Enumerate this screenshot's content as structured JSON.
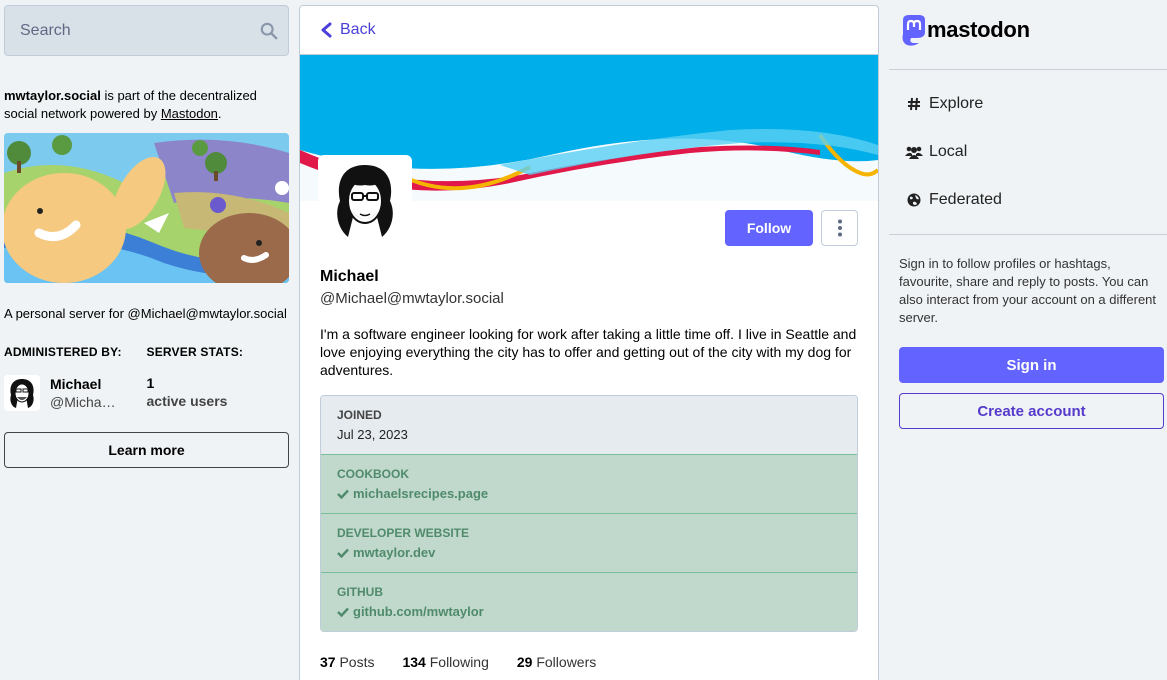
{
  "search": {
    "placeholder": "Search",
    "icon": "search-icon"
  },
  "server": {
    "domain": "mwtaylor.social",
    "about_middle": " is part of the decentralized social network powered by ",
    "about_link": "Mastodon",
    "about_end": ".",
    "description": "A personal server for @Michael@mwtaylor.social",
    "administered_by_label": "ADMINISTERED BY:",
    "server_stats_label": "SERVER STATS:",
    "admin_name": "Michael",
    "admin_handle": "@Michael@mwtaylor.social",
    "active_users_count": "1",
    "active_users_label": "active users",
    "learn_more": "Learn more"
  },
  "profile": {
    "back_label": "Back",
    "follow_label": "Follow",
    "display_name": "Michael",
    "handle": "@Michael@mwtaylor.social",
    "bio": "I'm a software engineer looking for work after taking a little time off. I live in Seattle and love enjoying everything the city has to offer and getting out of the city with my dog for adventures.",
    "joined_label": "JOINED",
    "joined_value": "Jul 23, 2023",
    "fields": [
      {
        "label": "COOKBOOK",
        "value": "michaelsrecipes.page"
      },
      {
        "label": "DEVELOPER WEBSITE",
        "value": "mwtaylor.dev"
      },
      {
        "label": "GITHUB",
        "value": "github.com/mwtaylor"
      }
    ],
    "posts_count": "37",
    "posts_label": "Posts",
    "following_count": "134",
    "following_label": "Following",
    "followers_count": "29",
    "followers_label": "Followers"
  },
  "sidebar": {
    "logo_text": "mastodon",
    "nav": [
      {
        "label": "Explore",
        "icon": "hashtag-icon"
      },
      {
        "label": "Local",
        "icon": "users-icon"
      },
      {
        "label": "Federated",
        "icon": "globe-icon"
      }
    ],
    "signin_prompt": "Sign in to follow profiles or hashtags, favourite, share and reply to posts. You can also interact from your account on a different server.",
    "signin_label": "Sign in",
    "create_account_label": "Create account"
  },
  "colors": {
    "brand": "#6364ff",
    "accent_text": "#563acc",
    "verified_bg": "#c1d8cd",
    "verified_text": "#4f8b6b"
  }
}
